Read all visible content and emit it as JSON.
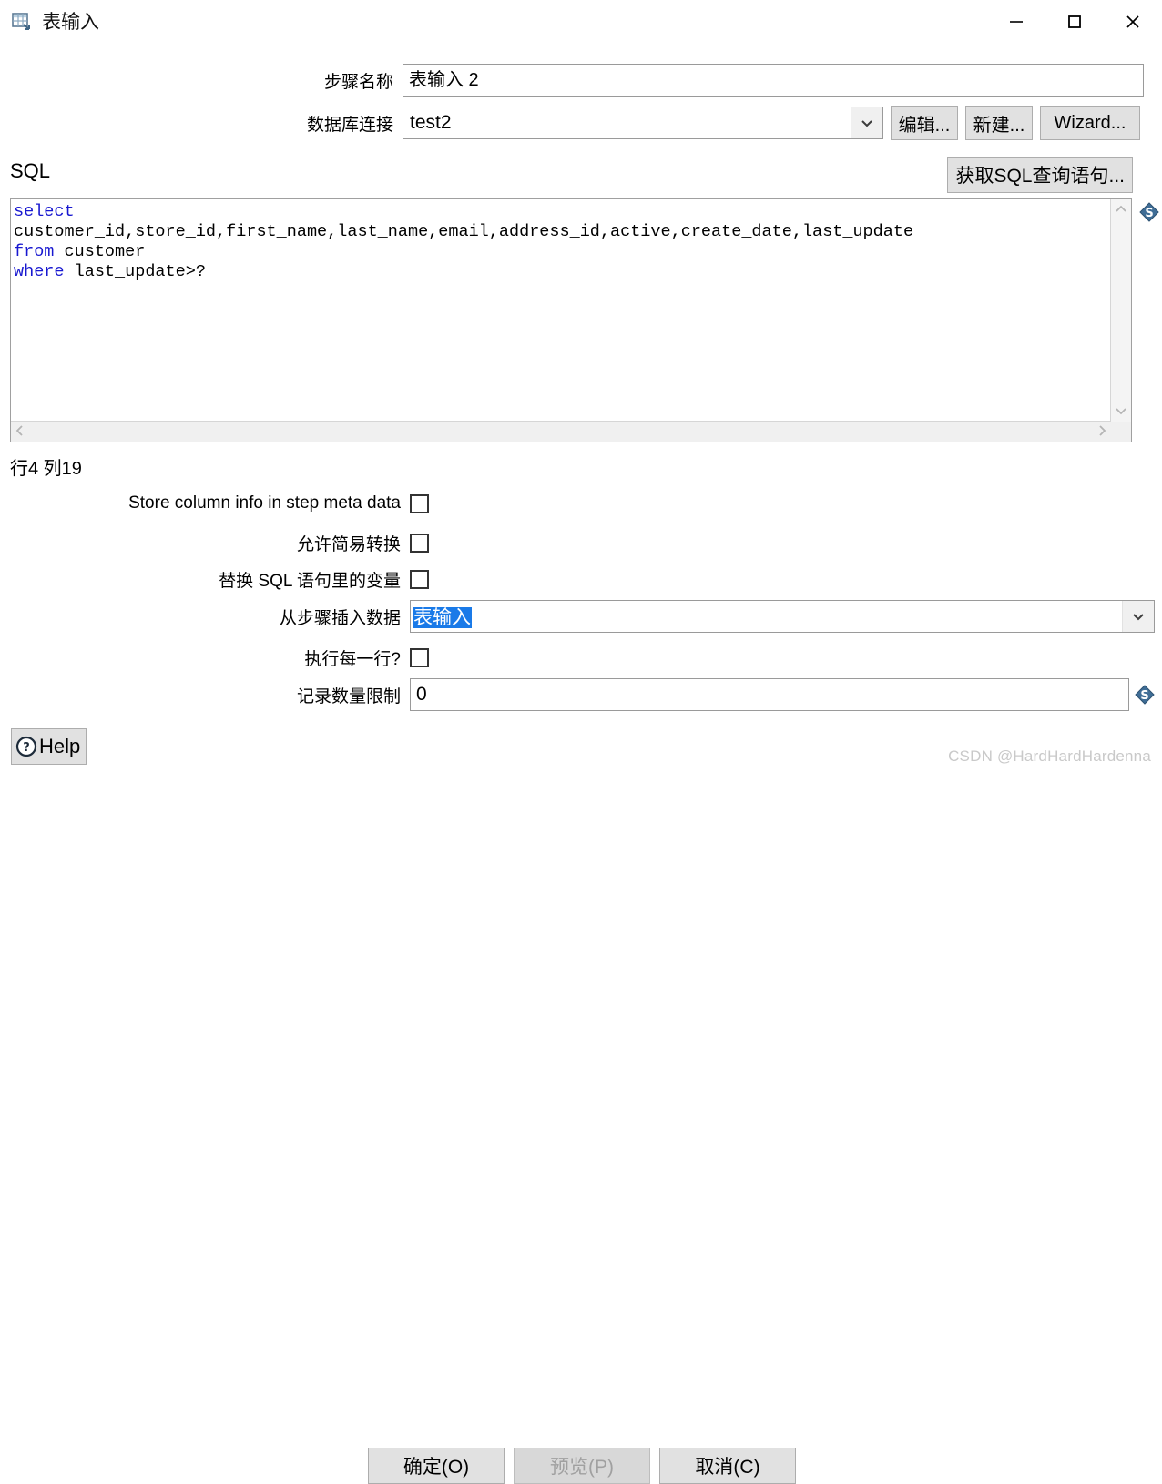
{
  "window": {
    "title": "表输入",
    "icon": "table-input-icon",
    "minimize_label": "—",
    "maximize_label": "□",
    "close_label": "✕"
  },
  "form": {
    "step_name_label": "步骤名称",
    "step_name_value": "表输入 2",
    "db_conn_label": "数据库连接",
    "db_conn_value": "test2",
    "edit_button": "编辑...",
    "new_button": "新建...",
    "wizard_button": "Wizard..."
  },
  "sql": {
    "section_label": "SQL",
    "get_sql_button": "获取SQL查询语句...",
    "lines": [
      {
        "keyword": "select",
        "rest": ""
      },
      {
        "keyword": "",
        "rest": "customer_id,store_id,first_name,last_name,email,address_id,active,create_date,last_update"
      },
      {
        "keyword": "from",
        "rest": " customer"
      },
      {
        "keyword": "where",
        "rest": " last_update>?"
      }
    ],
    "full_text": "select\ncustomer_id,store_id,first_name,last_name,email,address_id,active,create_date,last_update\nfrom customer\nwhere last_update>?",
    "keyword_color": "#1818d0",
    "status": "行4 列19",
    "variable_icon": "dollar-variable-icon"
  },
  "options": {
    "store_column_info_label": "Store column info in step meta data",
    "store_column_info_checked": false,
    "lazy_conversion_label": "允许简易转换",
    "lazy_conversion_checked": false,
    "replace_variables_label": "替换 SQL 语句里的变量",
    "replace_variables_checked": false,
    "insert_from_step_label": "从步骤插入数据",
    "insert_from_step_value": "表输入",
    "insert_from_step_selected": true,
    "execute_each_row_label": "执行每一行?",
    "execute_each_row_checked": false,
    "row_limit_label": "记录数量限制",
    "row_limit_value": "0",
    "row_limit_variable_icon": "dollar-variable-icon"
  },
  "footer": {
    "help_label": "Help",
    "help_icon": "question-circle-icon",
    "ok_label": "确定(O)",
    "preview_label": "预览(P)",
    "preview_disabled": true,
    "cancel_label": "取消(C)",
    "watermark": "CSDN @HardHardHardenna"
  },
  "colors": {
    "accent_selection": "#1a7ae8",
    "keyword": "#1818d0",
    "button_face": "#e1e1e1",
    "border": "#9a9a9a"
  }
}
